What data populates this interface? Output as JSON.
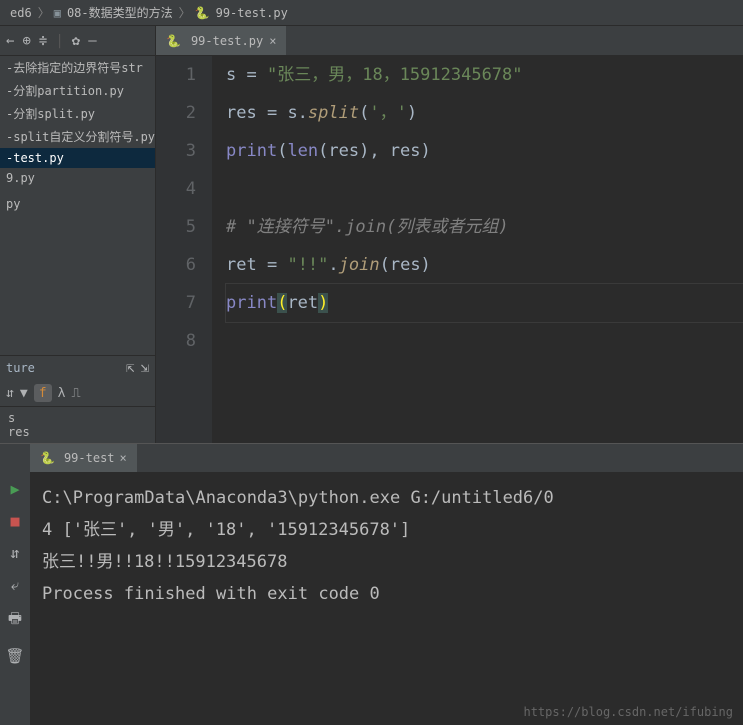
{
  "breadcrumb": {
    "root": "ed6",
    "folder": "08-数据类型的方法",
    "file": "99-test.py"
  },
  "tab": {
    "label": "99-test.py"
  },
  "files": [
    "-去除指定的边界符号str",
    "-分割partition.py",
    "-分割split.py",
    "-split自定义分割符号.py",
    "-test.py",
    "9.py",
    "",
    "py"
  ],
  "structure": {
    "label": "ture"
  },
  "vars": {
    "line1": "s",
    "line2": "res"
  },
  "gutter": [
    "1",
    "2",
    "3",
    "4",
    "5",
    "6",
    "7",
    "8"
  ],
  "code": {
    "l1_a": "s ",
    "l1_eq": "=",
    "l1_b": " ",
    "l1_str": "\"张三，男，18，15912345678\"",
    "l2_a": "res ",
    "l2_eq": "=",
    "l2_b": " s.",
    "l2_fn": "split",
    "l2_c": "(",
    "l2_str": "'，'",
    "l2_d": ")",
    "l3_a": "print",
    "l3_b": "(",
    "l3_c": "len",
    "l3_d": "(res), res)",
    "l5": "# \"连接符号\".join(列表或者元组)",
    "l6_a": "ret ",
    "l6_eq": "=",
    "l6_b": " ",
    "l6_str": "\"!!\"",
    "l6_c": ".",
    "l6_fn": "join",
    "l6_d": "(res)",
    "l7_a": "print",
    "l7_p1": "(",
    "l7_b": "ret",
    "l7_p2": ")"
  },
  "console": {
    "tab": "99-test",
    "out1": "C:\\ProgramData\\Anaconda3\\python.exe G:/untitled6/0",
    "out2": "4 ['张三', '男', '18', '15912345678']",
    "out3": "张三!!男!!18!!15912345678",
    "out4": "",
    "out5": "Process finished with exit code 0"
  },
  "watermark": "https://blog.csdn.net/ifubing"
}
